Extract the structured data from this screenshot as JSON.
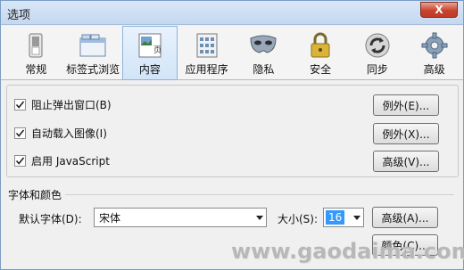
{
  "window": {
    "title": "选项",
    "close": "X"
  },
  "toolbar": {
    "tabs": [
      {
        "label": "常规",
        "icon": "switch-icon"
      },
      {
        "label": "标签式浏览",
        "icon": "tabs-window-icon"
      },
      {
        "label": "内容",
        "icon": "content-page-icon",
        "active": true
      },
      {
        "label": "应用程序",
        "icon": "applications-icon"
      },
      {
        "label": "隐私",
        "icon": "mask-icon"
      },
      {
        "label": "安全",
        "icon": "padlock-icon"
      },
      {
        "label": "同步",
        "icon": "sync-icon"
      },
      {
        "label": "高级",
        "icon": "gear-icon"
      }
    ]
  },
  "content": {
    "popups": {
      "label": "阻止弹出窗口(B)",
      "checked": true,
      "button": "例外(E)..."
    },
    "images": {
      "label": "自动载入图像(I)",
      "checked": true,
      "button": "例外(X)..."
    },
    "javascript": {
      "label": "启用 JavaScript",
      "checked": true,
      "button": "高级(V)..."
    }
  },
  "fonts": {
    "section_title": "字体和颜色",
    "default_font_label": "默认字体(D):",
    "default_font_value": "宋体",
    "size_label": "大小(S):",
    "size_value": "16",
    "advanced_button": "高级(A)...",
    "colors_button": "颜色(C)..."
  },
  "watermark": "www.gaodaima.com",
  "colors": {
    "accent": "#3399ff",
    "active_tab": "#d2e5f8"
  }
}
